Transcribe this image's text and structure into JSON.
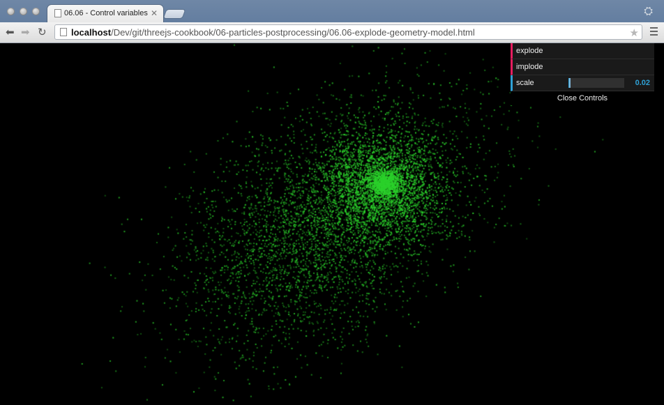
{
  "browser": {
    "tab_title": "06.06 - Control variables",
    "url_host": "localhost",
    "url_path": "/Dev/git/threejs-cookbook/06-particles-postprocessing/06.06-explode-geometry-model.html"
  },
  "gui": {
    "explode_label": "explode",
    "implode_label": "implode",
    "scale_label": "scale",
    "scale_value": "0.02",
    "scale_fraction": 0.02,
    "close_label": "Close Controls"
  },
  "scene": {
    "particle_color": "#2bd12b",
    "background_color": "#000000"
  }
}
